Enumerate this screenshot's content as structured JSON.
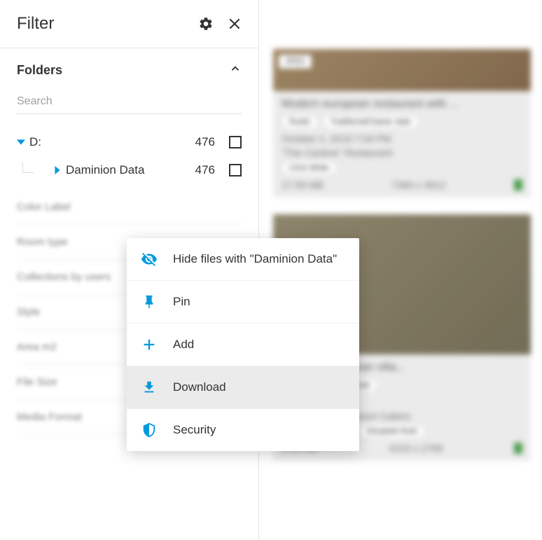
{
  "sidebar": {
    "title": "Filter",
    "folders_label": "Folders",
    "search_placeholder": "Search",
    "tree": [
      {
        "label": "D:",
        "count": "476",
        "expanded": true,
        "level": 0
      },
      {
        "label": "Daminion Data",
        "count": "476",
        "expanded": false,
        "level": 1
      }
    ],
    "filters": [
      {
        "label": "Color Label"
      },
      {
        "label": "Room type"
      },
      {
        "label": "Collections by users"
      },
      {
        "label": "Style"
      },
      {
        "label": "Area m2"
      },
      {
        "label": "File Size"
      },
      {
        "label": "Media Format"
      }
    ]
  },
  "context_menu": {
    "hide": "Hide files with \"Daminion Data\"",
    "pin": "Pin",
    "add": "Add",
    "download": "Download",
    "security": "Security"
  },
  "content": {
    "card1": {
      "badge": "JPEG",
      "title": "Modern european restaurant with ...",
      "tag1": "Rustic",
      "tag2": "Traditional/Classic style",
      "date": "October 2, 2019 7:04 PM",
      "place": "\"The Cantine\" Restaurant",
      "author": "Chris White",
      "size": "17.59 MB",
      "dims": "7360 x 4912"
    },
    "card2": {
      "title": "house in slovakian villa...",
      "tag1": "Traditional/Classic style",
      "date": "2019 8:47 PM",
      "place": "Snowmass Ski Resort Cabins",
      "author1": "Andrew Wanants",
      "author2": "Elizabeth Ruth",
      "size": "9.15 MB",
      "dims": "4153 x 2769"
    }
  },
  "colors": {
    "accent": "#0099dd"
  }
}
